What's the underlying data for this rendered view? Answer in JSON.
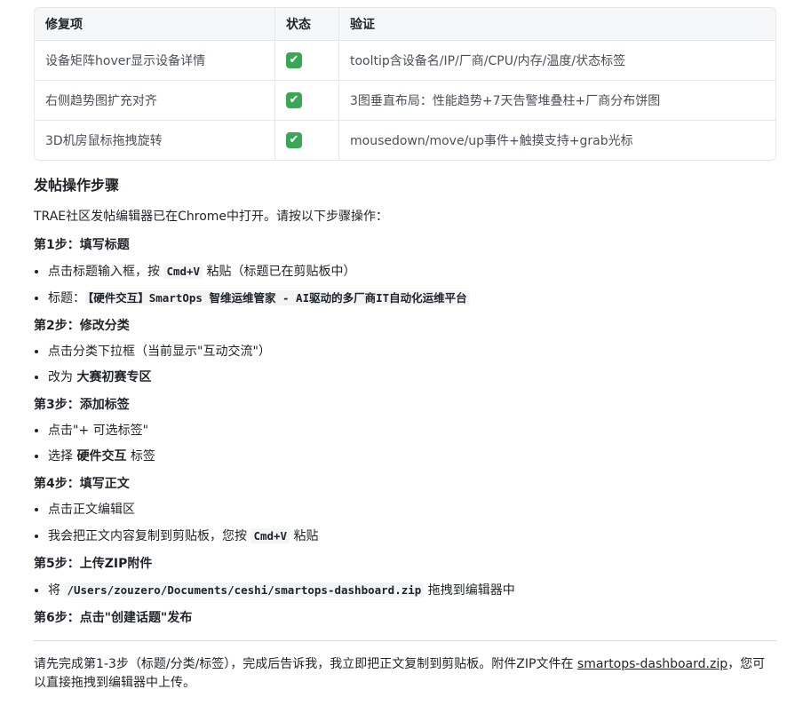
{
  "table": {
    "headers": [
      "修复项",
      "状态",
      "验证"
    ],
    "rows": [
      {
        "item": "设备矩阵hover显示设备详情",
        "status_icon": "check-mark-icon",
        "verify": "tooltip含设备名/IP/厂商/CPU/内存/温度/状态标签"
      },
      {
        "item": "右侧趋势图扩充对齐",
        "status_icon": "check-mark-icon",
        "verify": "3图垂直布局：性能趋势+7天告警堆叠柱+厂商分布饼图"
      },
      {
        "item": "3D机房鼠标拖拽旋转",
        "status_icon": "check-mark-icon",
        "verify": "mousedown/move/up事件+触摸支持+grab光标"
      }
    ],
    "status_symbol": "✔",
    "status_color": "#3aa757"
  },
  "section_title": "发帖操作步骤",
  "intro": "TRAE社区发帖编辑器已在Chrome中打开。请按以下步骤操作：",
  "steps": {
    "s1": {
      "title": "第1步：填写标题",
      "b1_pre": "点击标题输入框，按 ",
      "b1_code": "Cmd+V",
      "b1_post": " 粘贴（标题已在剪贴板中）",
      "b2_pre": "标题：",
      "b2_code": "【硬件交互】SmartOps 智维运维管家 - AI驱动的多厂商IT自动化运维平台"
    },
    "s2": {
      "title": "第2步：修改分类",
      "b1": "点击分类下拉框（当前显示\"互动交流\"）",
      "b2_pre": "改为 ",
      "b2_bold": "大赛初赛专区"
    },
    "s3": {
      "title": "第3步：添加标签",
      "b1": "点击\"+ 可选标签\"",
      "b2_pre": "选择 ",
      "b2_bold": "硬件交互",
      "b2_post": " 标签"
    },
    "s4": {
      "title": "第4步：填写正文",
      "b1": "点击正文编辑区",
      "b2_pre": "我会把正文内容复制到剪贴板，您按 ",
      "b2_code": "Cmd+V",
      "b2_post": " 粘贴"
    },
    "s5": {
      "title": "第5步：上传ZIP附件",
      "b1_pre": "将 ",
      "b1_code": "/Users/zouzero/Documents/ceshi/smartops-dashboard.zip",
      "b1_post": " 拖拽到编辑器中"
    },
    "s6": {
      "title": "第6步：点击\"创建话题\"发布"
    }
  },
  "final": {
    "pre": "请先完成第1-3步（标题/分类/标签），完成后告诉我，我立即把正文复制到剪贴板。附件ZIP文件在 ",
    "link": "smartops-dashboard.zip",
    "post": "，您可以直接拖拽到编辑器中上传。"
  }
}
